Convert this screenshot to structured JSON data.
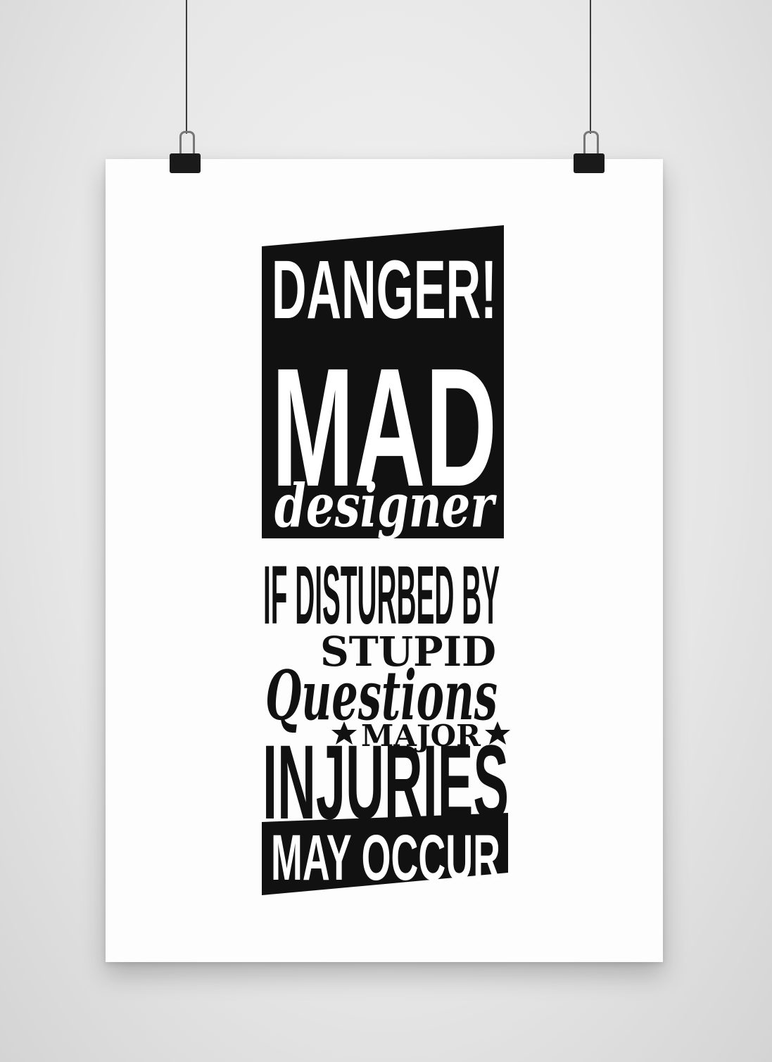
{
  "poster": {
    "line1": "DANGER!",
    "line2": "MAD",
    "line3": "designer",
    "line4": "IF DISTURBED BY",
    "line5": "STUPID",
    "line6": "Questions",
    "line7": "MAJOR",
    "line8": "INJURIES",
    "line9": "MAY OCCUR"
  },
  "colors": {
    "ink": "#111111",
    "paper": "#fdfdfd",
    "wall": "#e6e6e6"
  },
  "icons": [
    "binder-clip-icon",
    "star-icon"
  ]
}
